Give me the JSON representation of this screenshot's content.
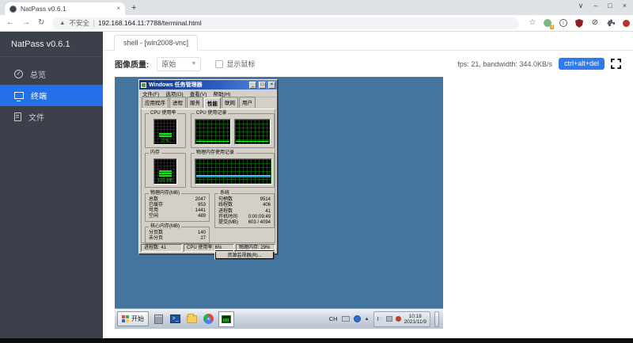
{
  "browser": {
    "tab_title": "NatPass v0.6.1",
    "tab_close": "×",
    "new_tab": "+",
    "security_label": "不安全",
    "url": "192.168.164.11:7788/terminal.html",
    "extension_badge": "2"
  },
  "sidebar": {
    "title": "NatPass v0.6.1",
    "items": [
      {
        "label": "总览"
      },
      {
        "label": "终端"
      },
      {
        "label": "文件"
      }
    ]
  },
  "session": {
    "tab_label": "shell - [win2008-vnc]",
    "quality_label": "图像质量:",
    "quality_value": "原始",
    "show_cursor_label": "显示鼠标",
    "stats_text": "fps: 21, bandwidth: 344.0KB/s",
    "cad_button": "ctrl+alt+del"
  },
  "taskmgr": {
    "title": "Windows 任务管理器",
    "menus": [
      "文件(F)",
      "选项(O)",
      "查看(V)",
      "帮助(H)"
    ],
    "tabs": [
      "应用程序",
      "进程",
      "服务",
      "性能",
      "联网",
      "用户"
    ],
    "cpu_gauge_label": "CPU 使用率",
    "cpu_gauge_value": "2 %",
    "cpu_history_label": "CPU 使用记录",
    "mem_gauge_label": "内存",
    "mem_gauge_value": "600 MB",
    "mem_history_label": "物理内存使用记录",
    "groups": {
      "physical": {
        "title": "物理内存(MB)",
        "rows": [
          {
            "label": "总数",
            "value": "2047"
          },
          {
            "label": "已缓存",
            "value": "953"
          },
          {
            "label": "可用",
            "value": "1441"
          },
          {
            "label": "空闲",
            "value": "489"
          }
        ]
      },
      "kernel": {
        "title": "核心内存(MB)",
        "rows": [
          {
            "label": "分页数",
            "value": "140"
          },
          {
            "label": "未分页",
            "value": "27"
          }
        ]
      },
      "system": {
        "title": "系统",
        "rows": [
          {
            "label": "句柄数",
            "value": "9514"
          },
          {
            "label": "线程数",
            "value": "406"
          },
          {
            "label": "进程数",
            "value": "41"
          },
          {
            "label": "开机时间",
            "value": "0:00:09:49"
          },
          {
            "label": "提交(MB)",
            "value": "603 / 4094"
          }
        ]
      }
    },
    "resmon_button": "资源监视器(R)...",
    "statusbar": [
      "进程数: 41",
      "CPU 使用率: 6%",
      "物理内存: 29%"
    ]
  },
  "win_taskbar": {
    "start_label": "开始",
    "tray_lang": "CH",
    "time": "10:18",
    "date": "2021/11/9"
  },
  "colors": {
    "accent_blue": "#2d7bf0",
    "sidebar_bg": "#3b404b",
    "sidebar_active": "#2470e8",
    "desktop_blue": "#44759e",
    "classic_gray": "#d4d0c8",
    "graph_green": "#21ff21",
    "mem_line_blue": "#1e8fe0"
  }
}
